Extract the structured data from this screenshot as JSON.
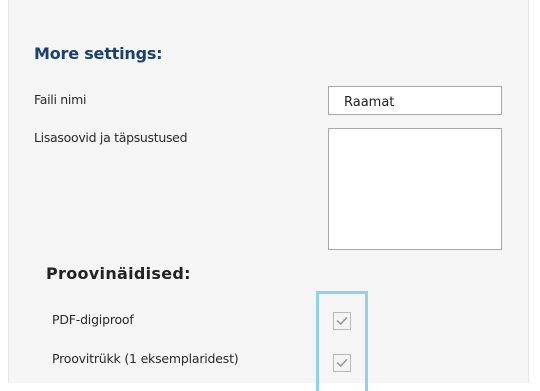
{
  "settings": {
    "title": "More settings:",
    "filename_label": "Faili nimi",
    "filename_value": "Raamat",
    "notes_label": "Lisasoovid ja täpsustused",
    "notes_value": ""
  },
  "proofs": {
    "title": "Proovinäidised:",
    "options": [
      {
        "label": "PDF-digiproof",
        "checked": true,
        "icon": "checkmark-icon"
      },
      {
        "label": "Proovitrükk (1 eksemplaridest)",
        "checked": true,
        "icon": "checkmark-icon"
      }
    ]
  },
  "colors": {
    "section_title": "#1b3f6e",
    "highlight": "#8ed3ea",
    "panel_background": "#f5f5f5"
  }
}
